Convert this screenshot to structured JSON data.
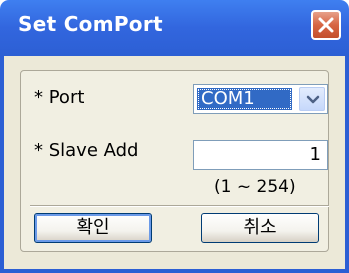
{
  "window": {
    "title": "Set ComPort",
    "close_icon": "close-icon"
  },
  "form": {
    "port_label": "* Port",
    "port_value": "COM1",
    "slave_label": "* Slave Add",
    "slave_value": "1",
    "range_hint": "(1 ~ 254)"
  },
  "buttons": {
    "ok_label": "확인",
    "cancel_label": "취소"
  },
  "colors": {
    "titlebar": "#3266de",
    "client": "#ece9d8",
    "selection": "#316ac5",
    "close_button": "#d76543"
  }
}
